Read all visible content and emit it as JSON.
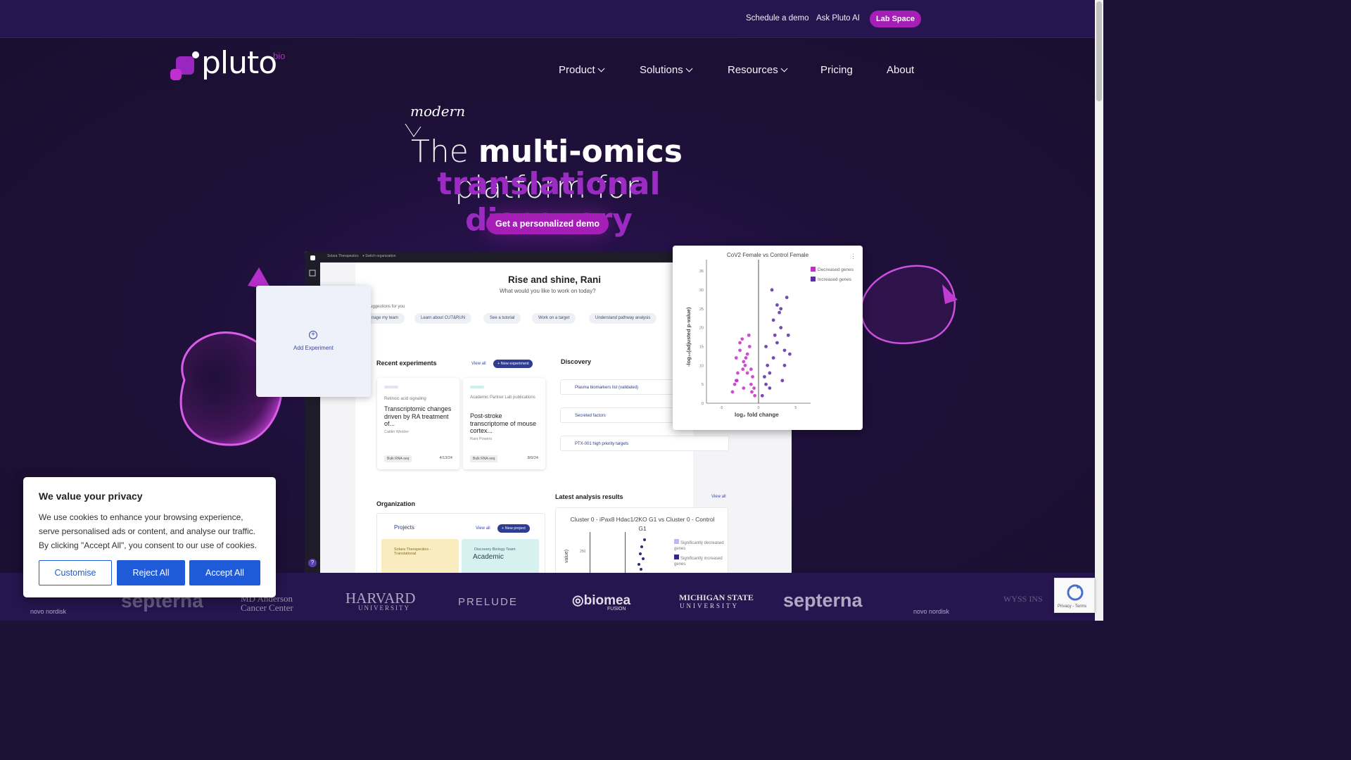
{
  "topbar": {
    "schedule_demo": "Schedule a demo",
    "ask_ai": "Ask Pluto AI",
    "lab_space": "Lab Space"
  },
  "logo": {
    "word": "pluto",
    "suffix": "bio"
  },
  "nav": {
    "product": "Product",
    "solutions": "Solutions",
    "resources": "Resources",
    "pricing": "Pricing",
    "about": "About"
  },
  "hero": {
    "annotation": "modern",
    "headline_pre": "The ",
    "headline_bold": "multi-omics",
    "headline_post": " platform for",
    "headline_accent": "translational discovery",
    "cta": "Get a personalized demo"
  },
  "app": {
    "org": "Solara Therapeutics",
    "switch_org": "Switch organization",
    "greeting": "Rise and shine, Rani",
    "greeting_sub": "What would you like to work on today?",
    "suggestions_label": "uggestions for you",
    "suggestions": [
      "nage my team",
      "Learn about CUT&RUN",
      "See a tutorial",
      "Work on a target",
      "Understand pathway analysis"
    ],
    "recent_experiments": "Recent experiments",
    "view_all": "View all",
    "new_experiment": "+  New experiment",
    "cards": [
      {
        "category": "Retinoic acid signaling",
        "title": "Transcriptomic changes driven by RA treatment of...",
        "author": "Caitlin Winkler",
        "tag": "Bulk RNA-seq",
        "date": "4/13/24"
      },
      {
        "category": "Academic Partner Lab publications",
        "title": "Post-stroke transcriptome of mouse cortex...",
        "author": "Rani Powers",
        "tag": "Bulk RNA-seq",
        "date": "8/9/24"
      }
    ],
    "discovery": "Discovery",
    "discovery_items": [
      "Plasma biomarkers list (validated)",
      "Secreted factors",
      "PTX-001 high priority targets"
    ],
    "organization": "Organization",
    "projects": "Projects",
    "new_project": "+  New project",
    "project_cards": [
      "Solara Therapeutics - Translational",
      "Discovery Biology Team"
    ],
    "project_card_2_title": "Academic",
    "latest_results": "Latest analysis results",
    "latest_title": "Cluster 0 - iPax8 Hdac1/2KO G1 vs Cluster 0 - Control G1",
    "latest_legend": [
      "Significantly decreased genes",
      "Significantly increased genes"
    ],
    "latest_y_tick": "250",
    "latest_y_label": "value)",
    "add_experiment": "Add Experiment",
    "help": "?"
  },
  "volcano": {
    "title": "CoV2 Female vs Control Female",
    "legend": [
      "Decreased genes",
      "Increased genes"
    ],
    "ylabel": "-log₁₀(adjusted p-value)",
    "xlabel": "log₂ fold change",
    "yticks": [
      "0",
      "5",
      "10",
      "15",
      "20",
      "25",
      "30",
      "35"
    ],
    "xticks": [
      "-5",
      "0",
      "5"
    ]
  },
  "chart_data": {
    "type": "scatter",
    "title": "CoV2 Female vs Control Female",
    "xlabel": "log₂ fold change",
    "ylabel": "-log₁₀(adjusted p-value)",
    "xlim": [
      -7,
      7
    ],
    "ylim": [
      0,
      38
    ],
    "series": [
      {
        "name": "Decreased genes",
        "color": "#c42fc9",
        "x": [
          -0.5,
          -1,
          -1.5,
          -2,
          -2.5,
          -3,
          -3.5,
          -1,
          -2,
          -3,
          -1.2,
          -2.2,
          -0.8,
          -1.8,
          -2.8,
          -1.5,
          -2.5,
          -3.2,
          -0.6,
          -1.3,
          -2.1,
          -2.9,
          -1.7,
          -0.9
        ],
        "y": [
          2,
          5,
          8,
          11,
          14,
          6,
          3,
          9,
          4,
          12,
          15,
          17,
          7,
          10,
          8,
          13,
          16,
          5,
          4,
          18,
          9,
          6,
          12,
          3
        ]
      },
      {
        "name": "Increased genes",
        "color": "#5b2ca3",
        "x": [
          0.5,
          1,
          1.5,
          2,
          2.5,
          3,
          3.5,
          1,
          2,
          3,
          4,
          2.5,
          3.5,
          1.5,
          1.2,
          2.2,
          3.2,
          4.2,
          1.8,
          2.8,
          3.8,
          0.8
        ],
        "y": [
          2,
          5,
          8,
          12,
          16,
          20,
          10,
          15,
          22,
          25,
          18,
          26,
          14,
          4,
          10,
          18,
          6,
          13,
          30,
          24,
          28,
          7
        ]
      }
    ]
  },
  "cookie": {
    "title": "We value your privacy",
    "body": "We use cookies to enhance your browsing experience, serve personalised ads or content, and analyse our traffic. By clicking \"Accept All\", you consent to our use of cookies.",
    "customise": "Customise",
    "reject": "Reject All",
    "accept": "Accept All"
  },
  "logos": [
    "novo nordisk",
    "septerna",
    "MD Anderson Cancer Center",
    "HARVARD",
    "UNIVERSITY",
    "PRELUDE",
    "biomea",
    "FUSION",
    "MICHIGAN STATE",
    "UNIVERSITY",
    "septerna",
    "novo nordisk",
    "WYSS INS"
  ],
  "recaptcha": {
    "terms": "Privacy - Terms"
  },
  "colors": {
    "accent": "#a51fb6",
    "accent_text": "#9b2bc2",
    "topbar": "#26154e",
    "cookie_button": "#1f5ad9"
  }
}
